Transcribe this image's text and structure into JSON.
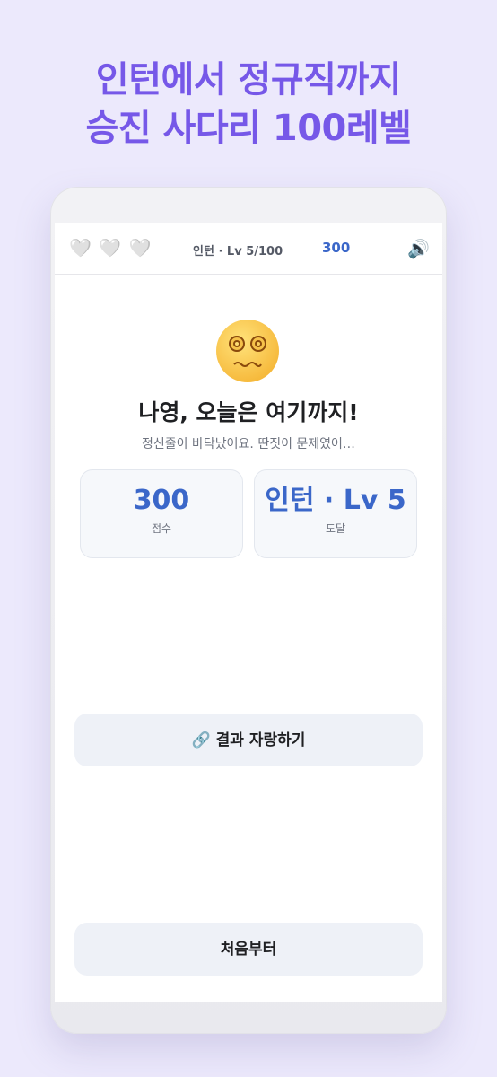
{
  "promo": {
    "line1": "인턴에서 정규직까지",
    "line2": "승진 사다리 100레벨"
  },
  "topbar": {
    "hearts": [
      "🤍",
      "🤍",
      "🤍"
    ],
    "level": "인턴 · Lv 5/100",
    "score": "300",
    "sound_icon": "🔊"
  },
  "result": {
    "emoji_icon": "dizzy-face-icon",
    "title": "나영, 오늘은 여기까지!",
    "subtitle": "정신줄이 바닥났어요. 딴짓이 문제였어…"
  },
  "stats": [
    {
      "value": "300",
      "label": "점수"
    },
    {
      "value": "인턴 · Lv 5",
      "label": "도달"
    }
  ],
  "buttons": {
    "share_icon": "🔗",
    "share_label": "결과 자랑하기",
    "restart_label": "처음부터"
  },
  "colors": {
    "background": "#ece9fc",
    "promo_text": "#7658e8",
    "accent": "#3b67c9",
    "button_bg": "#eef1f7"
  }
}
